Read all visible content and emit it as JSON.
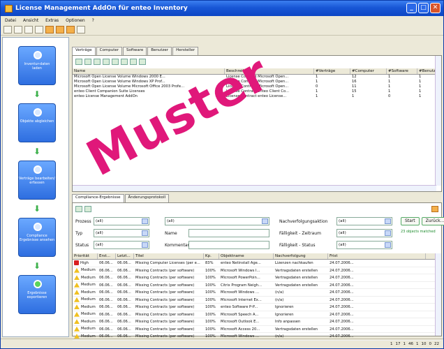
{
  "window": {
    "title": "License Management AddOn für enteo Inventory"
  },
  "menu": [
    "Datei",
    "Ansicht",
    "Extras",
    "Optionen",
    "?"
  ],
  "sidebar": {
    "steps": [
      {
        "label": "Inventur-daten laden"
      },
      {
        "label": "Objekte abgleichen"
      },
      {
        "label": "Verträge bearbeiten/ erfassen"
      },
      {
        "label": "Compliance Ergebnisse ansehen"
      },
      {
        "label": "Ergebnisse exportieren"
      }
    ]
  },
  "top_tabs": [
    "Verträge",
    "Computer",
    "Software",
    "Benutzer",
    "Hersteller"
  ],
  "contracts": {
    "columns": [
      "Name",
      "Beschreibung",
      "#Verträge",
      "#Computer",
      "#Software",
      "#Benutz..."
    ],
    "rows": [
      [
        "Microsoft Open License Volume Windows 2000 E...",
        "License Contract Microsoft Open...",
        "1",
        "12",
        "1",
        "1"
      ],
      [
        "Microsoft Open License Volume Windows XP Prof...",
        "License Contract Microsoft Open...",
        "1",
        "16",
        "1",
        "1"
      ],
      [
        "Microsoft Open License Volume Microsoft Office 2003 Profe...",
        "License Contract Microsoft Open...",
        "0",
        "11",
        "1",
        "1"
      ],
      [
        "enteo Client Companion Suite Licenses",
        "License Contract enteo Client Co...",
        "1",
        "15",
        "1",
        "1"
      ],
      [
        "enteo License Management AddOn",
        "License Contract enteo License...",
        "1",
        "1",
        "0",
        "1"
      ]
    ]
  },
  "bottom_tabs": [
    "Compliance-Ergebnisse",
    "Änderungsprotokoll"
  ],
  "filters": {
    "prozess_label": "Prozess",
    "prozess_value": "(all)",
    "typ_label": "Typ",
    "typ_value": "(all)",
    "status_label": "Status",
    "status_value": "(all)",
    "col2_value": "(all)",
    "name_label": "Name",
    "kommentar_label": "Kommentar",
    "nv_label": "Nachverfolgungsaktion",
    "nv_value": "(all)",
    "fz_label": "Fälligkeit - Zeitraum",
    "fz_value": "(all)",
    "fs_label": "Fälligkeit - Status",
    "fs_value": "(all)",
    "start_btn": "Start",
    "reset_btn": "Zurück...",
    "count_link": "23 objects matched"
  },
  "results": {
    "columns": [
      "Priorität",
      "Erst...",
      "Letzt...",
      "Titel",
      "Kp.",
      "Objektname",
      "Nachverfolgung",
      "Frist"
    ],
    "rows": [
      [
        "High",
        "06.06...",
        "06.06...",
        "Missing Computer Licenses (per e...",
        "83%",
        "enteo Netinstall Age...",
        "Lizenzen nachkaufen",
        "24.07.2006..."
      ],
      [
        "Medium",
        "06.06...",
        "06.06...",
        "Missing Contracts (per software)",
        "100%",
        "Microsoft Windows I...",
        "Vertragsdaten erstellen",
        "24.07.2006..."
      ],
      [
        "Medium",
        "06.06...",
        "06.06...",
        "Missing Contracts (per software)",
        "100%",
        "Microsoft PowerPoin...",
        "Vertragsdaten erstellen",
        "24.07.2006..."
      ],
      [
        "Medium",
        "06.06...",
        "06.06...",
        "Missing Contracts (per software)",
        "100%",
        "Citrix Program Neigh...",
        "Vertragsdaten erstellen",
        "24.07.2006..."
      ],
      [
        "Medium",
        "06.06...",
        "06.06...",
        "Missing Contracts (per software)",
        "100%",
        "Microsoft Windows ...",
        "(n/a)",
        "24.07.2006..."
      ],
      [
        "Medium",
        "06.06...",
        "06.06...",
        "Missing Contracts (per software)",
        "100%",
        "Microsoft Internet Ex...",
        "(n/a)",
        "24.07.2006..."
      ],
      [
        "Medium",
        "06.06...",
        "06.06...",
        "Missing Contracts (per software)",
        "100%",
        "enteo Software P-P...",
        "Ignorieren",
        "24.07.2006..."
      ],
      [
        "Medium",
        "06.06...",
        "06.06...",
        "Missing Contracts (per software)",
        "100%",
        "Microsoft Speech A...",
        "Ignorieren",
        "24.07.2006..."
      ],
      [
        "Medium",
        "06.06...",
        "06.06...",
        "Missing Contracts (per software)",
        "100%",
        "Microsoft Outlook E...",
        "Info anpassen",
        "24.07.2006..."
      ],
      [
        "Medium",
        "06.06...",
        "06.06...",
        "Missing Contracts (per software)",
        "100%",
        "Microsoft Access 20...",
        "Vertragsdaten erstellen",
        "24.07.2006..."
      ],
      [
        "Medium",
        "06.06...",
        "06.06...",
        "Missing Contracts (per software)",
        "100%",
        "Microsoft Windows ...",
        "(n/a)",
        "24.07.2006..."
      ]
    ]
  },
  "status_bar": [
    "1",
    "17",
    "1",
    "46",
    "1",
    "10",
    "0",
    "22"
  ],
  "watermark": "Muster"
}
